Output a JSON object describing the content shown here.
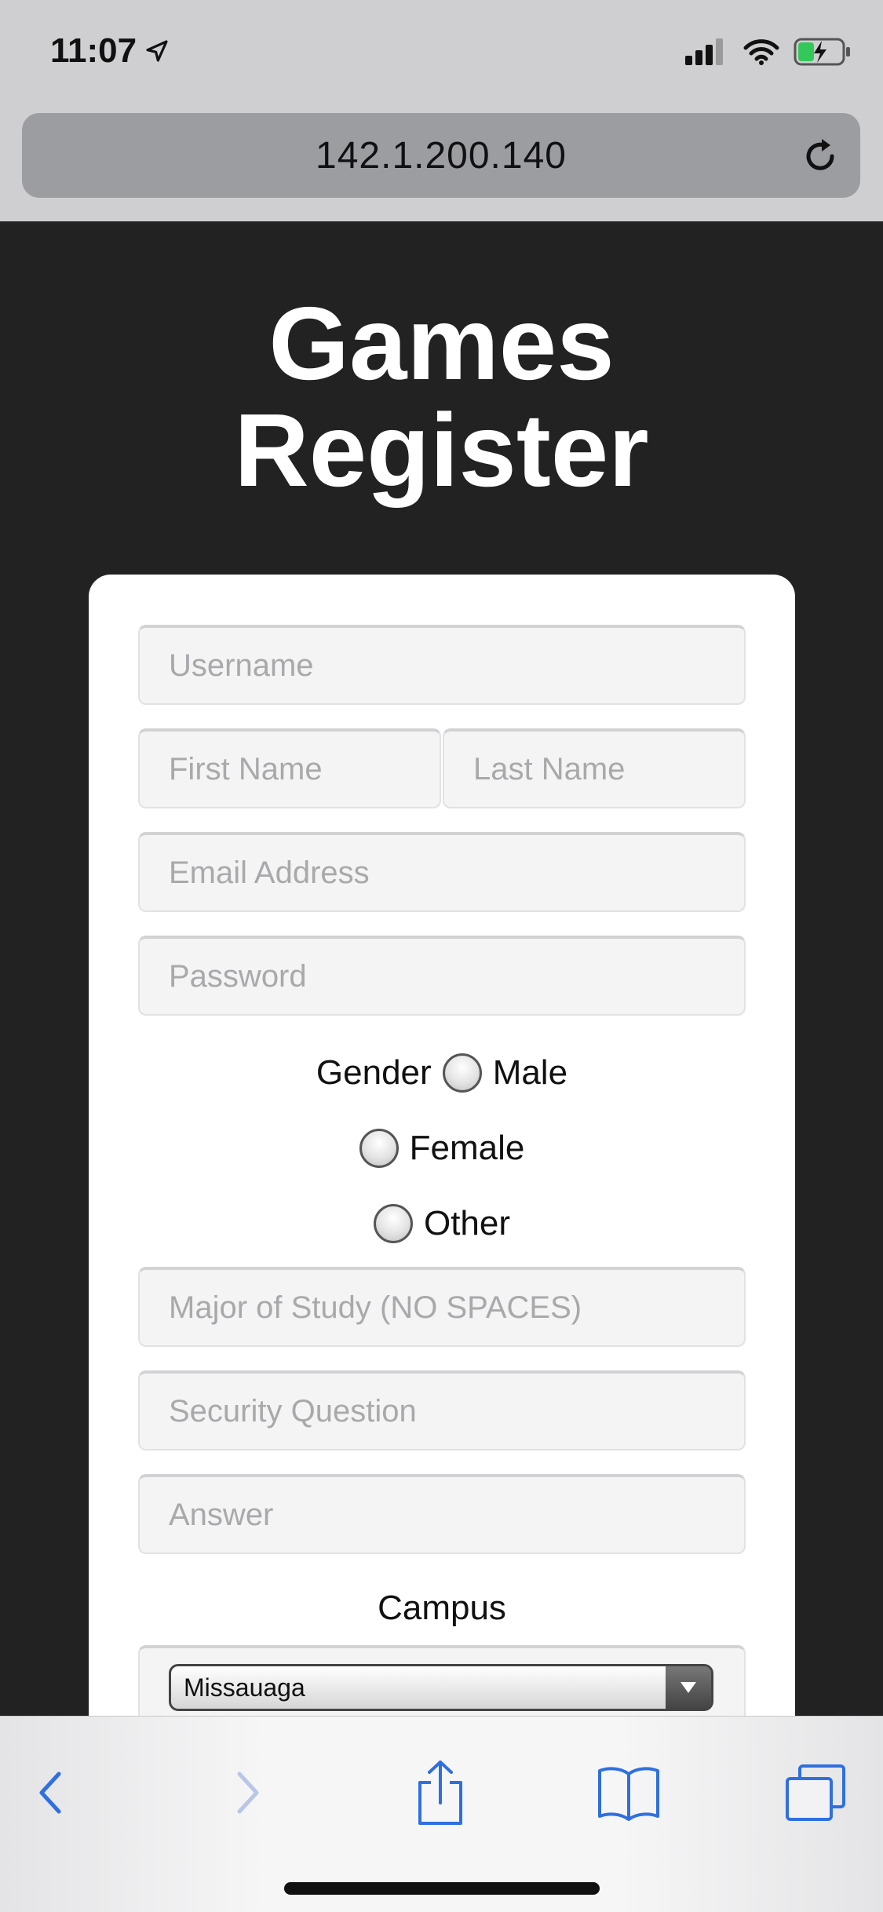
{
  "status_bar": {
    "time": "11:07",
    "icons": [
      "location-arrow-icon",
      "signal-icon",
      "wifi-icon",
      "battery-charging-icon"
    ]
  },
  "browser": {
    "url": "142.1.200.140",
    "reload_icon": "reload-icon"
  },
  "page": {
    "title_line1": "Games",
    "title_line2": "Register"
  },
  "form": {
    "username_placeholder": "Username",
    "first_name_placeholder": "First Name",
    "last_name_placeholder": "Last Name",
    "email_placeholder": "Email Address",
    "password_placeholder": "Password",
    "gender_label": "Gender",
    "gender_options": [
      "Male",
      "Female",
      "Other"
    ],
    "major_placeholder": "Major of Study (NO SPACES)",
    "security_question_placeholder": "Security Question",
    "answer_placeholder": "Answer",
    "campus_label": "Campus",
    "campus_selected": "Missauaga"
  },
  "toolbar": {
    "items": [
      "back-icon",
      "forward-icon",
      "share-icon",
      "bookmarks-icon",
      "tabs-icon"
    ]
  },
  "colors": {
    "page_background": "#222222",
    "chrome_background": "#cfcfd1",
    "url_bar": "#9c9da1",
    "toolbar_icon_active": "#2f6fe0",
    "toolbar_icon_disabled": "#b9c6e6"
  }
}
